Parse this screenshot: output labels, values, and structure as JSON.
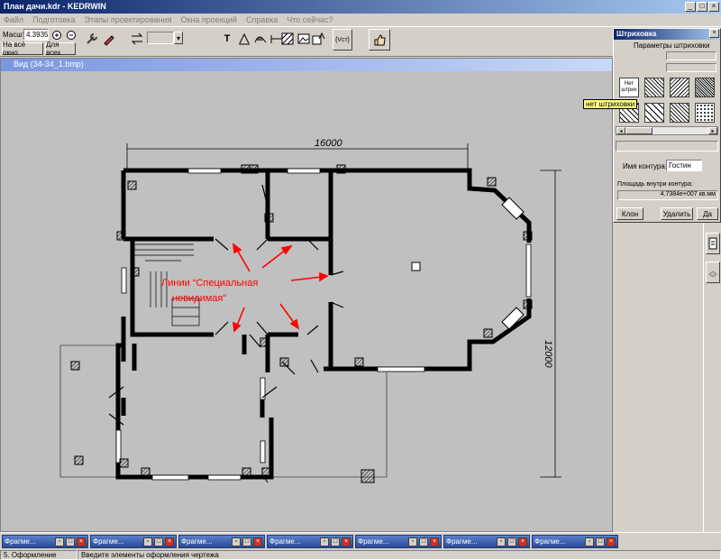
{
  "window": {
    "title": "План дачи.kdr - KEDRWIN"
  },
  "menu": [
    "Файл",
    "Подготовка",
    "Этапы проектирования",
    "Окна проекций",
    "Справка",
    "Что сейчас?"
  ],
  "toolbar": {
    "scale_label": "Масшт",
    "scale_value": "4.3935",
    "fit_window": "На всё окно",
    "fit_all": "Для всех",
    "text_tool": "T",
    "formula_tool": "{Vст}"
  },
  "document": {
    "title": "Вид (34-34_1.bmp)"
  },
  "drawing": {
    "dim_horizontal": "16000",
    "dim_vertical": "12000",
    "annotation_line1": "Линии “Специальная",
    "annotation_line2": "невидимая”",
    "annotation_color": "#ff0000"
  },
  "hatch_panel": {
    "title": "Штриховка",
    "params_label": "Параметры штриховки",
    "no_hatch_swatch": "Нет штрих",
    "tooltip": "нет штриховки",
    "contour_name_label": "Имя контура:",
    "contour_name_value": "Гостин",
    "area_label": "Площадь внутри контура:",
    "area_value": "4.7384e+007 кв.мм",
    "btn_clone": "Клон",
    "btn_delete": "Удалить",
    "btn_yes": "Да"
  },
  "taskbar": {
    "items": [
      "Фрагме...",
      "Фрагме...",
      "Фрагме...",
      "Фрагме...",
      "Фрагме...",
      "Фрагме...",
      "Фрагме..."
    ]
  },
  "status": {
    "step": "5. Оформление",
    "hint": "Введите элементы оформления чертежа"
  }
}
